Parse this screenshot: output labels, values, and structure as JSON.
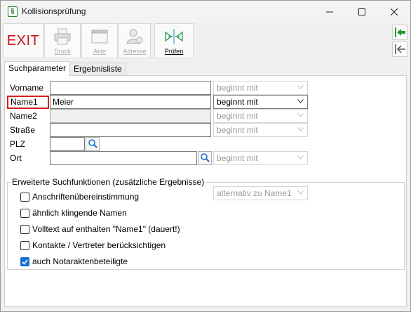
{
  "window": {
    "title": "Kollisionsprüfung",
    "app_icon_glyph": "§"
  },
  "toolbar": {
    "exit_label": "EXIT",
    "buttons": [
      {
        "label": "Druck",
        "icon": "printer-icon",
        "enabled": false
      },
      {
        "label": "Akte",
        "icon": "folder-window-icon",
        "enabled": false
      },
      {
        "label": "Adresse",
        "icon": "person-address-icon",
        "enabled": false
      },
      {
        "label": "Prüfen",
        "icon": "collision-check-icon",
        "enabled": true
      }
    ],
    "side_buttons": [
      {
        "icon": "arrow-left-enter-icon",
        "color": "#1f9a2e"
      },
      {
        "icon": "arrow-left-exit-icon",
        "color": "#555555"
      }
    ]
  },
  "tabs": [
    {
      "label": "Suchparameter",
      "active": true
    },
    {
      "label": "Ergebnisliste",
      "active": false
    }
  ],
  "form": {
    "vorname": {
      "label": "Vorname",
      "value": "",
      "mode": "beginnt mit"
    },
    "name1": {
      "label": "Name1",
      "value": "Meier",
      "mode": "beginnt mit"
    },
    "name2": {
      "label": "Name2",
      "value": "",
      "mode": "beginnt mit"
    },
    "strasse": {
      "label": "Straße",
      "value": "",
      "mode": "beginnt mit"
    },
    "plz": {
      "label": "PLZ",
      "value": ""
    },
    "ort": {
      "label": "Ort",
      "value": "",
      "mode": "beginnt mit"
    }
  },
  "extended": {
    "legend": "Erweiterte Suchfunktionen (zusätzliche Ergebnisse)",
    "match_mode": "alternativ zu Name1",
    "options": [
      {
        "label": "Anschriftenübereinstimmung",
        "checked": false
      },
      {
        "label": "ähnlich klingende Namen",
        "checked": false
      },
      {
        "label": "Volltext auf enthalten \"Name1\" (dauert!)",
        "checked": false
      },
      {
        "label": "Kontakte / Vertreter berücksichtigen",
        "checked": false
      },
      {
        "label": "auch Notaraktenbeteiligte",
        "checked": true
      }
    ]
  },
  "colors": {
    "exit_red": "#d01010",
    "highlight_red": "#d42020",
    "checkbox_blue": "#1a6fd0",
    "green_arrow": "#1f9a2e"
  }
}
